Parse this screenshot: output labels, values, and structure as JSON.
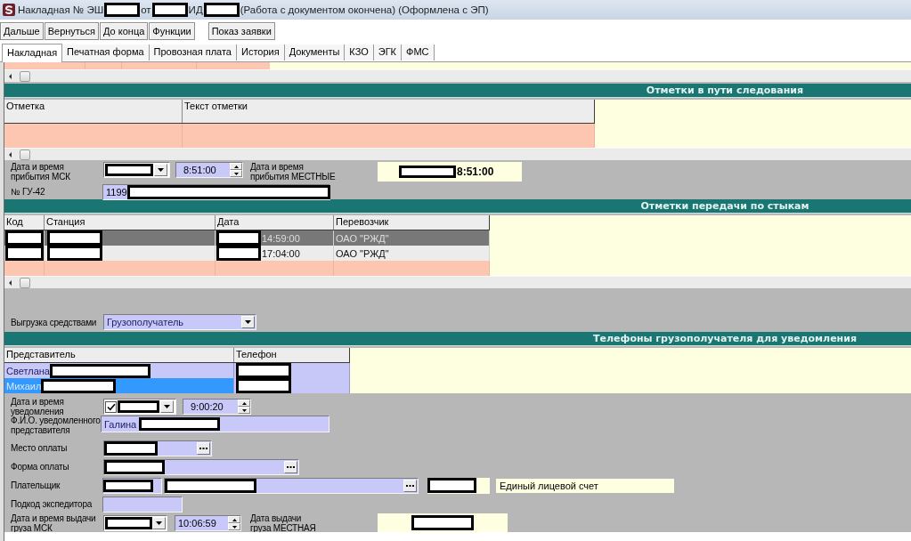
{
  "window": {
    "title": [
      {
        "kind": "text",
        "text": "Накладная № ЭШ"
      },
      {
        "kind": "redacted"
      },
      {
        "kind": "text",
        "text": "от"
      },
      {
        "kind": "redacted"
      },
      {
        "kind": "text",
        "text": "ИД"
      },
      {
        "kind": "redacted"
      },
      {
        "kind": "text",
        "text": "(Работа с документом окончена) (Оформлена с ЭП)"
      }
    ]
  },
  "toolbar": {
    "groups": [
      [
        "Дальше",
        "Вернуться",
        "До конца",
        "Функции"
      ],
      [
        "Показ заявки"
      ]
    ]
  },
  "tabs": [
    {
      "label": "Накладная",
      "selected": true
    },
    {
      "label": "Печатная форма",
      "selected": false
    },
    {
      "label": "Провозная плата",
      "selected": false
    },
    {
      "label": "История",
      "selected": false
    },
    {
      "label": "Документы",
      "selected": false
    },
    {
      "label": "КЗО",
      "selected": false
    },
    {
      "label": "ЭГК",
      "selected": false
    },
    {
      "label": "ФМС",
      "selected": false
    }
  ],
  "route_marks": {
    "title": "Отметки в пути следования",
    "columns": [
      "Отметка",
      "Текст отметки"
    ]
  },
  "arrival": {
    "msk_label": "Дата и время прибытия МСК",
    "date_redacted": true,
    "time": "8:51:00",
    "local_label": "Дата и время прибытия МЕСТНЫЕ",
    "local_redacted": true,
    "local_time": "8:51:00",
    "gu42_label": "№ ГУ-42",
    "gu42_value": "1199",
    "gu42_redacted": true
  },
  "junction_marks": {
    "title": "Отметки передачи по стыкам",
    "columns": [
      "Код",
      "Станция",
      "Дата",
      "Перевозчик"
    ],
    "rows": [
      {
        "selected": true,
        "cells": [
          {
            "redacted": true
          },
          {
            "redacted": true
          },
          {
            "redacted": true,
            "text": "14:59:00"
          },
          {
            "redacted": false,
            "text": "ОАО \"РЖД\""
          }
        ]
      },
      {
        "selected": false,
        "cells": [
          {
            "redacted": true
          },
          {
            "redacted": true
          },
          {
            "redacted": true,
            "text": "17:04:00"
          },
          {
            "redacted": false,
            "text": "ОАО \"РЖД\""
          }
        ]
      }
    ]
  },
  "unloading": {
    "label": "Выгрузка средствами",
    "value": "Грузополучатель"
  },
  "notify_phones": {
    "title": "Телефоны грузополучателя для уведомления",
    "columns": [
      "Представитель",
      "Телефон"
    ],
    "rows": [
      {
        "selected": false,
        "cells": [
          {
            "redacted": true,
            "text": "Светлана"
          },
          {
            "redacted": true
          }
        ]
      },
      {
        "selected": true,
        "cells": [
          {
            "redacted": true,
            "text": "Михаил"
          },
          {
            "redacted": true
          }
        ]
      }
    ]
  },
  "notification": {
    "label": "Дата и время уведомления",
    "checked": true,
    "date_redacted": true,
    "time": "9:00:20"
  },
  "notified_person": {
    "label": "Ф.И.О. уведомленного представителя",
    "value": "Галина",
    "redacted": true
  },
  "payment_place": {
    "label": "Место оплаты",
    "redacted": true
  },
  "payment_form": {
    "label": "Форма оплаты",
    "redacted": true
  },
  "payer": {
    "label": "Плательщик",
    "code_redacted": true,
    "name_redacted": true,
    "extra_redacted": true,
    "account_type": "Единый лицевой счет"
  },
  "forwarder_subcode": {
    "label": "Подкод экспедитора"
  },
  "issue": {
    "msk_label": "Дата и время выдачи груза МСК",
    "date_redacted": true,
    "time": "10:06:59",
    "local_label": "Дата выдачи груза МЕСТНАЯ",
    "local_redacted": true
  }
}
